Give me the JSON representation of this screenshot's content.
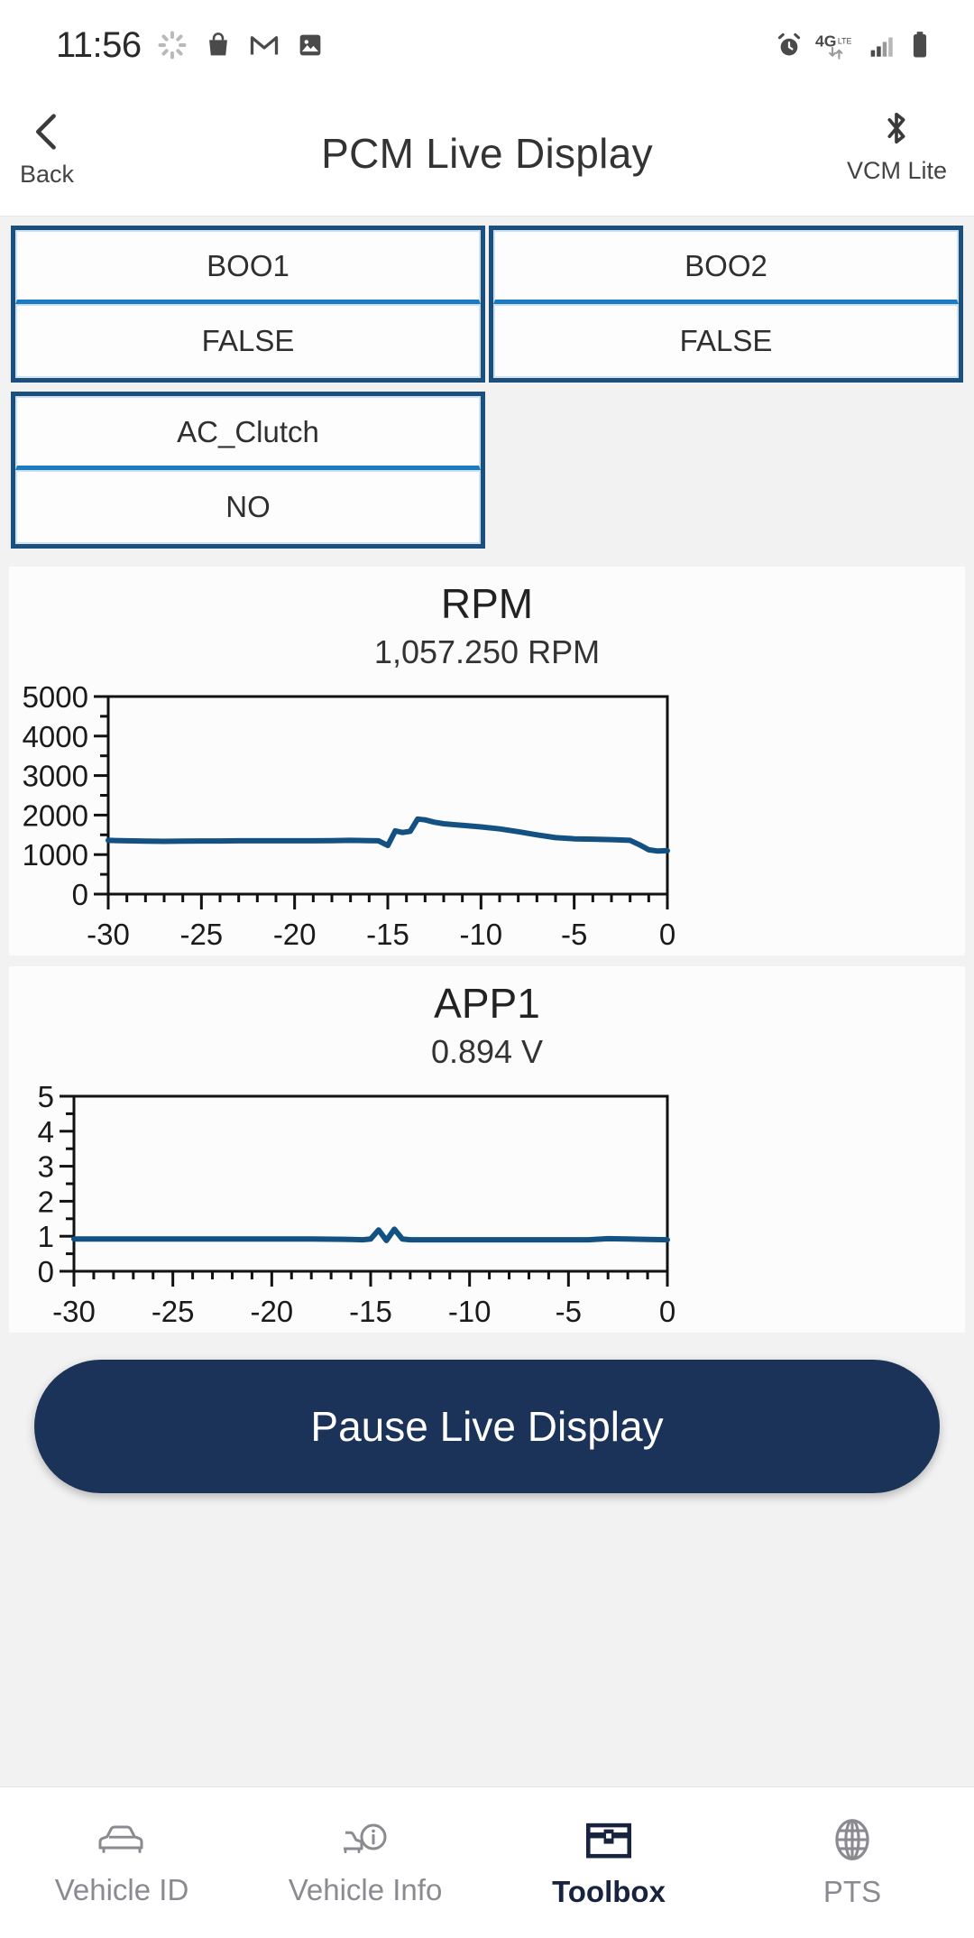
{
  "status_bar": {
    "time": "11:56",
    "left_icons": [
      "loading-spinner-icon",
      "shopping-bag-icon",
      "gmail-icon",
      "photos-icon"
    ],
    "right_icons": [
      "alarm-clock-icon",
      "4g-lte-icon",
      "signal-bars-icon",
      "battery-icon"
    ]
  },
  "header": {
    "back_label": "Back",
    "title": "PCM Live Display",
    "device_label": "VCM Lite",
    "back_icon": "chevron-left-icon",
    "bluetooth_icon": "bluetooth-icon"
  },
  "tiles": [
    {
      "name": "BOO1",
      "value": "FALSE"
    },
    {
      "name": "BOO2",
      "value": "FALSE"
    },
    {
      "name": "AC_Clutch",
      "value": "NO"
    }
  ],
  "colors": {
    "tile_border": "#1b4f7e",
    "tile_divider": "#1a7ac4",
    "series": "#135182",
    "button": "#1b3358",
    "active_nav": "#17233f"
  },
  "button": {
    "label": "Pause Live Display"
  },
  "bottom_nav": {
    "items": [
      {
        "label": "Vehicle ID",
        "icon": "car-icon",
        "active": false
      },
      {
        "label": "Vehicle Info",
        "icon": "car-info-icon",
        "active": false
      },
      {
        "label": "Toolbox",
        "icon": "toolbox-icon",
        "active": true
      },
      {
        "label": "PTS",
        "icon": "globe-icon",
        "active": false
      }
    ]
  },
  "chart_data": [
    {
      "type": "line",
      "title": "RPM",
      "subtitle": "1,057.250 RPM",
      "value": 1057.25,
      "unit": "RPM",
      "xlabel": "",
      "ylabel": "",
      "xlim": [
        -30,
        0
      ],
      "ylim": [
        0,
        5000
      ],
      "xticks": [
        -30,
        -25,
        -20,
        -15,
        -10,
        -5,
        0
      ],
      "yticks": [
        0,
        1000,
        2000,
        3000,
        4000,
        5000
      ],
      "minor_ytick_step": 500,
      "minor_xtick_step": 1,
      "grid": false,
      "legend": "none",
      "series": [
        {
          "name": "RPM",
          "color": "#135182",
          "x": [
            -30,
            -29,
            -28,
            -27,
            -26,
            -25,
            -24,
            -23,
            -22,
            -21,
            -20,
            -19,
            -18,
            -17,
            -16,
            -15.5,
            -15,
            -14.6,
            -14.2,
            -13.8,
            -13.4,
            -13,
            -12.5,
            -12,
            -11,
            -10,
            -9,
            -8,
            -7,
            -6,
            -5,
            -4,
            -3,
            -2,
            -1.5,
            -1,
            -0.5,
            0
          ],
          "y": [
            1360,
            1350,
            1340,
            1335,
            1340,
            1345,
            1345,
            1350,
            1350,
            1350,
            1350,
            1350,
            1355,
            1360,
            1355,
            1350,
            1230,
            1600,
            1560,
            1590,
            1900,
            1880,
            1820,
            1780,
            1740,
            1700,
            1650,
            1580,
            1500,
            1430,
            1400,
            1390,
            1380,
            1360,
            1250,
            1120,
            1090,
            1100
          ]
        }
      ]
    },
    {
      "type": "line",
      "title": "APP1",
      "subtitle": "0.894 V",
      "value": 0.894,
      "unit": "V",
      "xlabel": "",
      "ylabel": "",
      "xlim": [
        -30,
        0
      ],
      "ylim": [
        0,
        5
      ],
      "xticks": [
        -30,
        -25,
        -20,
        -15,
        -10,
        -5,
        0
      ],
      "yticks": [
        0,
        1,
        2,
        3,
        4,
        5
      ],
      "minor_ytick_step": 0.5,
      "minor_xtick_step": 1,
      "grid": false,
      "legend": "none",
      "series": [
        {
          "name": "APP1",
          "color": "#135182",
          "x": [
            -30,
            -27,
            -24,
            -21,
            -18,
            -16,
            -15.4,
            -15,
            -14.6,
            -14.2,
            -13.8,
            -13.4,
            -13,
            -12,
            -10,
            -8,
            -6,
            -4,
            -3,
            -2,
            -1,
            0
          ],
          "y": [
            0.92,
            0.92,
            0.92,
            0.92,
            0.92,
            0.91,
            0.9,
            0.92,
            1.18,
            0.88,
            1.2,
            0.92,
            0.9,
            0.9,
            0.9,
            0.9,
            0.9,
            0.9,
            0.93,
            0.92,
            0.91,
            0.9
          ]
        }
      ]
    }
  ]
}
